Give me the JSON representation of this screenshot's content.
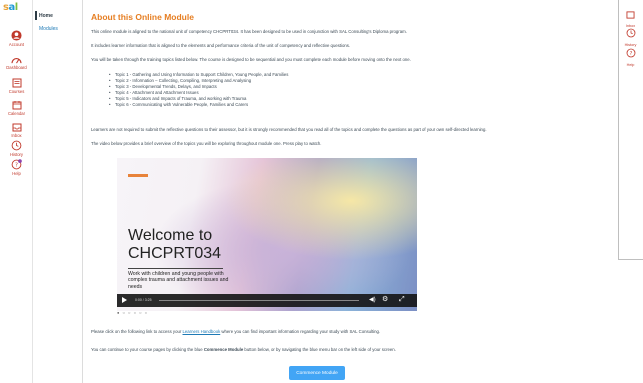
{
  "brand": {
    "logo_text": "sal"
  },
  "global_nav": [
    {
      "id": "account",
      "label": "Account",
      "icon": "account-icon"
    },
    {
      "id": "dashboard",
      "label": "Dashboard",
      "icon": "dashboard-icon"
    },
    {
      "id": "courses",
      "label": "Courses",
      "icon": "courses-icon"
    },
    {
      "id": "calendar",
      "label": "Calendar",
      "icon": "calendar-icon"
    },
    {
      "id": "inbox",
      "label": "Inbox",
      "icon": "inbox-icon"
    },
    {
      "id": "history",
      "label": "History",
      "icon": "history-icon"
    },
    {
      "id": "help",
      "label": "Help",
      "icon": "help-icon"
    }
  ],
  "course_nav": {
    "home": "Home",
    "modules": "Modules"
  },
  "page": {
    "title": "About this Online Module",
    "intro": "This online module is aligned to the national unit of competency CHCPRT034.  It has been designed to be used in conjunction with SAL Consulting's Diploma program.",
    "learner_info": "It includes learner information that is aligned to the elements and performance criteria of the unit of competency and reflective questions.",
    "sequence": "You will be taken through the training topics listed below. The course is designed to be sequential and you must complete each module before moving onto the next one.",
    "topics": [
      "Topic 1 - Gathering and Using Information to Support Children, Young People, and Families",
      "Topic 2 - Information – Collecting, Compiling, Interpreting and Analysing",
      "Topic 3 - Developmental Trends, Delays, and Impacts",
      "Topic 4 - Attachment and Attachment Issues",
      "Topic 5 - Indicators and Impacts of Trauma, and working with Trauma",
      "Topic 6 - Communicating with Vulnerable People, Families and Carers"
    ],
    "reflective": "Learners are not required to submit the reflective questions to their assessor, but it is strongly recommended that you read all of the topics and complete the questions as part of your own self-directed learning.",
    "video_intro": "The video below provides a brief overview of the topics you will be exploring throughout module one. Press play to watch.",
    "handbook_pre": "Please click on the following link to access your ",
    "handbook_link": "Learners Handbook",
    "handbook_post": " where you can find important information regarding your study with SAL Consulting.",
    "continue_pre": "You can continue to your course pages by clicking the blue ",
    "continue_bold": "Commence Module",
    "continue_post": " button below, or by navigating the blue menu bar on the left side of your screen.",
    "commence_button": "Commence Module"
  },
  "video": {
    "welcome": "Welcome to",
    "code": "CHCPRT034",
    "subtitle": "Work with children and young people with complex trauma and attachment issues and needs",
    "time": "0:00 / 3:25",
    "dots": "● ○ ○ ○ ○ ○"
  },
  "right_panel": [
    {
      "label": "Inbox",
      "icon": "inbox-icon"
    },
    {
      "label": "History",
      "icon": "history-icon"
    },
    {
      "label": "Help",
      "icon": "help-icon"
    }
  ],
  "colors": {
    "accent_red": "#c0392b",
    "title_orange": "#e67e22",
    "button_blue": "#42a5f5",
    "link_blue": "#1e7ab6"
  }
}
